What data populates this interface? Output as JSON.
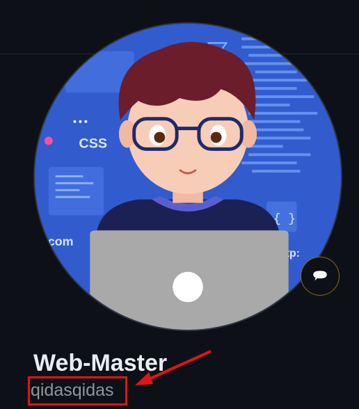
{
  "profile": {
    "display_name": "Web-Master",
    "username": "qidasqidas"
  },
  "avatar": {
    "css_label": "CSS",
    "com_label": ".com",
    "brackets_label": "{ }",
    "tp_label": "tp:"
  },
  "status": {
    "icon": "speech-bubble-icon"
  },
  "colors": {
    "background": "#0d1117",
    "avatar_blue": "#2f56c9",
    "name_color": "#e6edf3",
    "username_color": "#8d96a0",
    "annotation_red": "#e01515"
  }
}
